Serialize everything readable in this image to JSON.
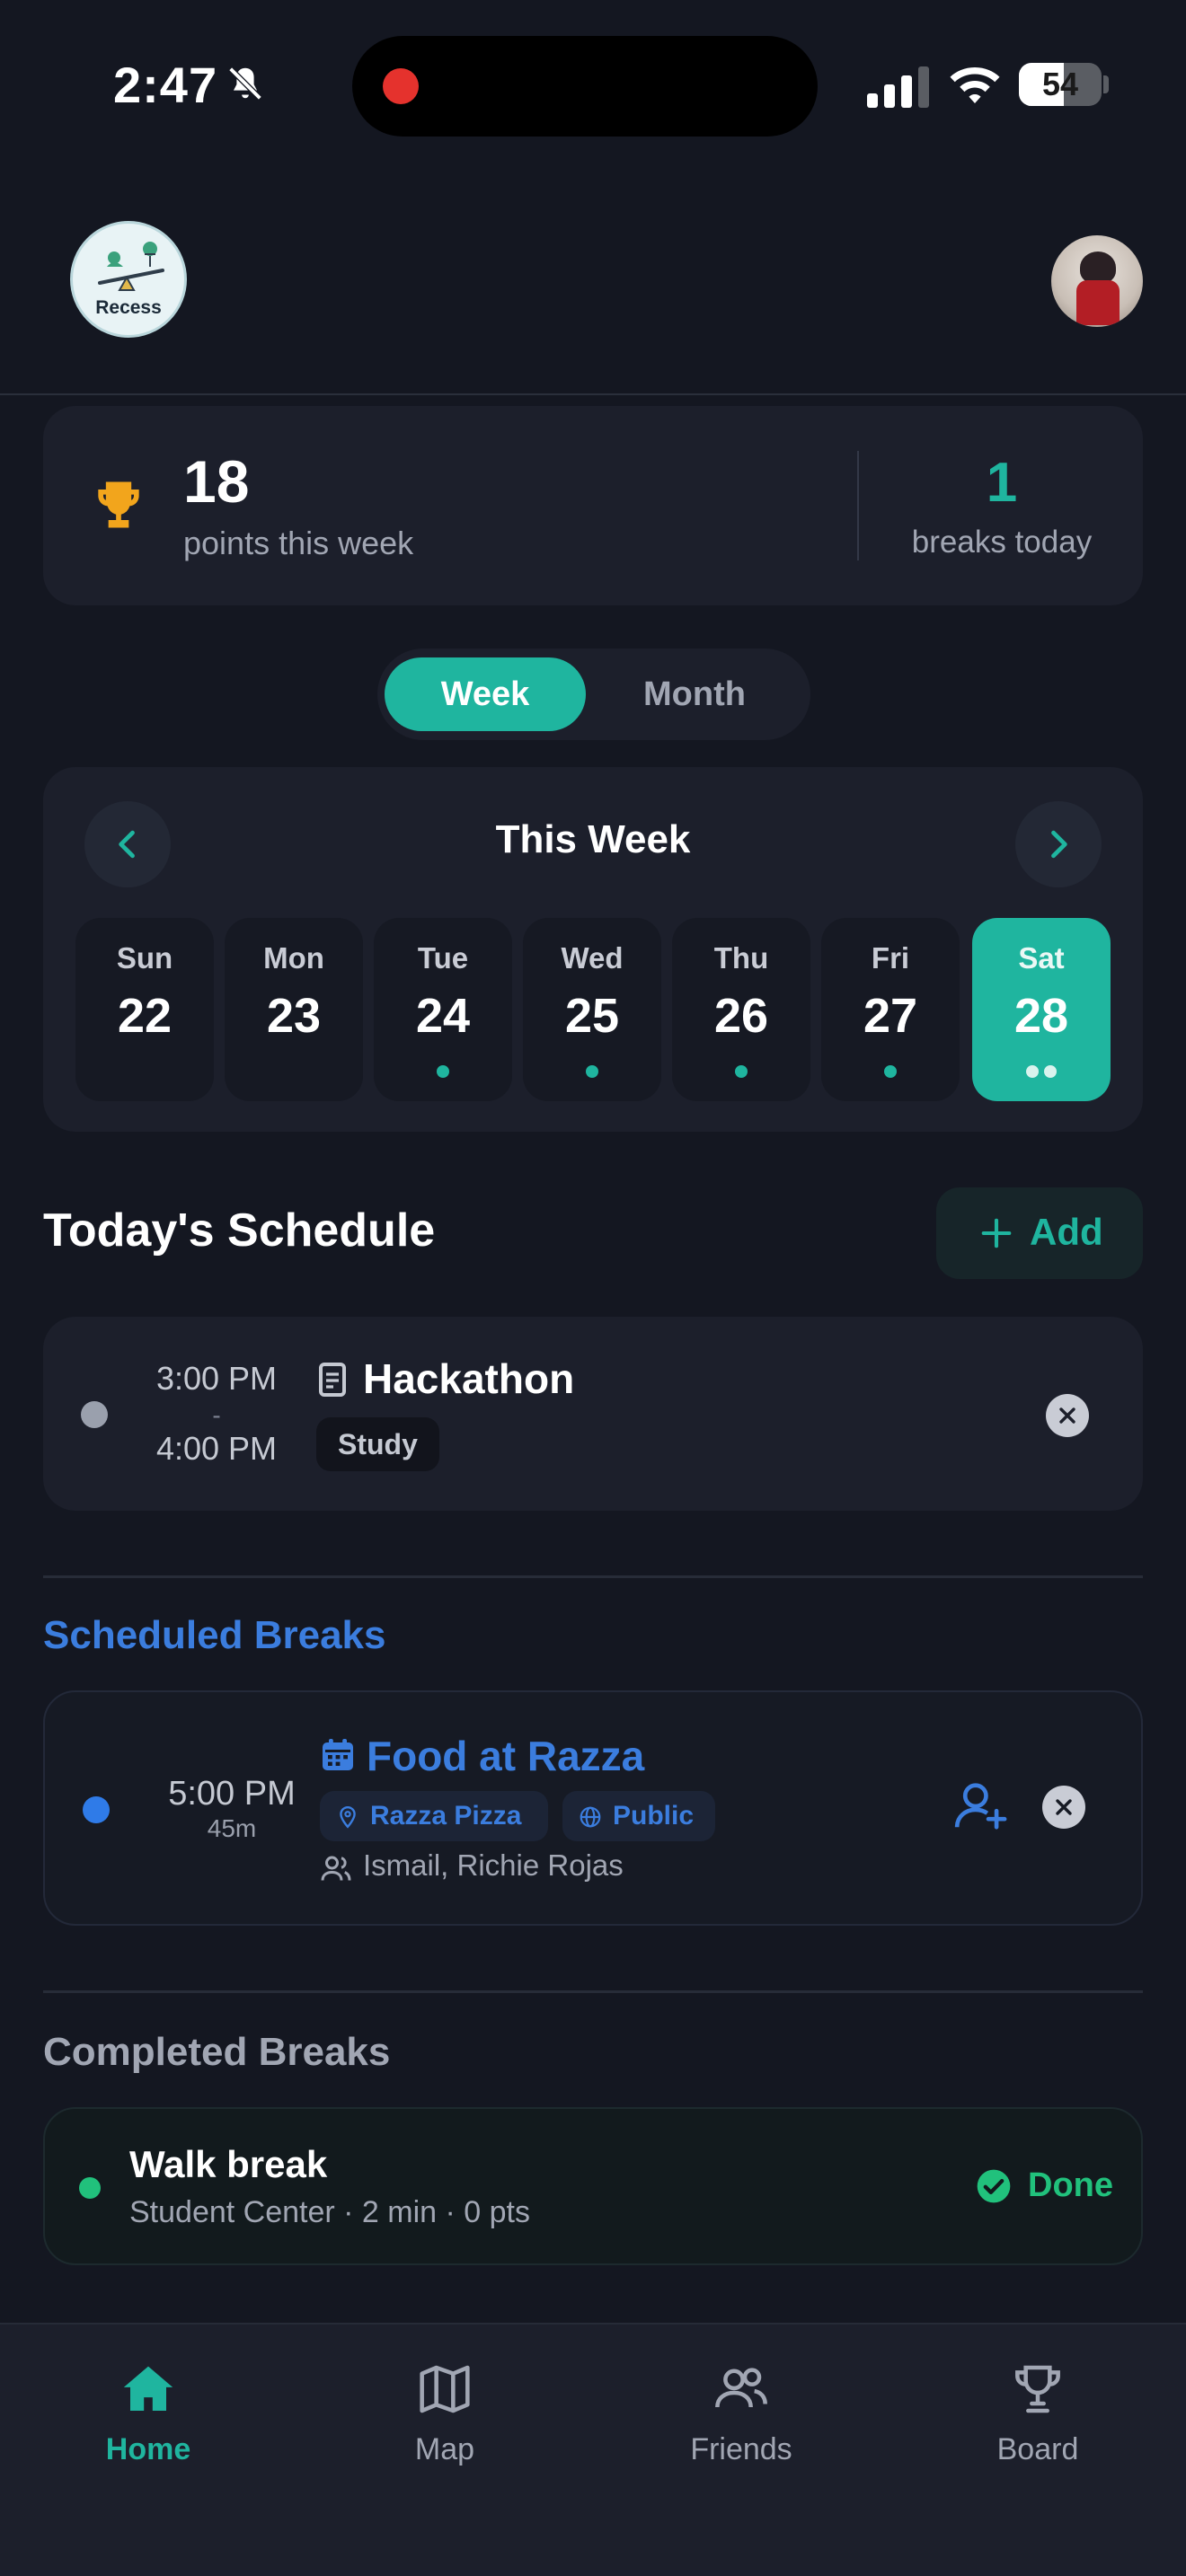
{
  "status_bar": {
    "time": "2:47",
    "battery": "54",
    "battery_level": 0.54
  },
  "header": {
    "logo_text": "Recess"
  },
  "stats": {
    "points_value": "18",
    "points_label": "points this week",
    "breaks_value": "1",
    "breaks_label": "breaks today"
  },
  "view_toggle": {
    "week_label": "Week",
    "month_label": "Month",
    "selected": "Week"
  },
  "calendar": {
    "title": "This Week",
    "days": [
      {
        "name": "Sun",
        "num": "22",
        "dots": 0,
        "selected": false
      },
      {
        "name": "Mon",
        "num": "23",
        "dots": 0,
        "selected": false
      },
      {
        "name": "Tue",
        "num": "24",
        "dots": 1,
        "selected": false
      },
      {
        "name": "Wed",
        "num": "25",
        "dots": 1,
        "selected": false
      },
      {
        "name": "Thu",
        "num": "26",
        "dots": 1,
        "selected": false
      },
      {
        "name": "Fri",
        "num": "27",
        "dots": 1,
        "selected": false
      },
      {
        "name": "Sat",
        "num": "28",
        "dots": 2,
        "selected": true
      }
    ]
  },
  "schedule": {
    "title": "Today's Schedule",
    "add_label": "Add",
    "event": {
      "start": "3:00 PM",
      "separator": "-",
      "end": "4:00 PM",
      "title": "Hackathon",
      "tag": "Study"
    }
  },
  "scheduled_breaks": {
    "title": "Scheduled Breaks",
    "item": {
      "time": "5:00 PM",
      "duration": "45m",
      "title": "Food at Razza",
      "place": "Razza Pizza",
      "visibility": "Public",
      "people": "Ismail, Richie Rojas"
    }
  },
  "completed_breaks": {
    "title": "Completed Breaks",
    "item": {
      "title": "Walk break",
      "subtitle": "Student Center · 2 min · 0 pts",
      "status": "Done"
    }
  },
  "bottom_nav": {
    "tabs": [
      {
        "label": "Home",
        "icon": "home-icon",
        "active": true
      },
      {
        "label": "Map",
        "icon": "map-icon",
        "active": false
      },
      {
        "label": "Friends",
        "icon": "friends-icon",
        "active": false
      },
      {
        "label": "Board",
        "icon": "trophy-icon",
        "active": false
      }
    ]
  },
  "colors": {
    "accent": "#1fb59f",
    "blue": "#3b7dde",
    "green": "#21c17c",
    "trophy": "#f2a51c",
    "background": "#141721",
    "card": "#1c1f2b"
  }
}
